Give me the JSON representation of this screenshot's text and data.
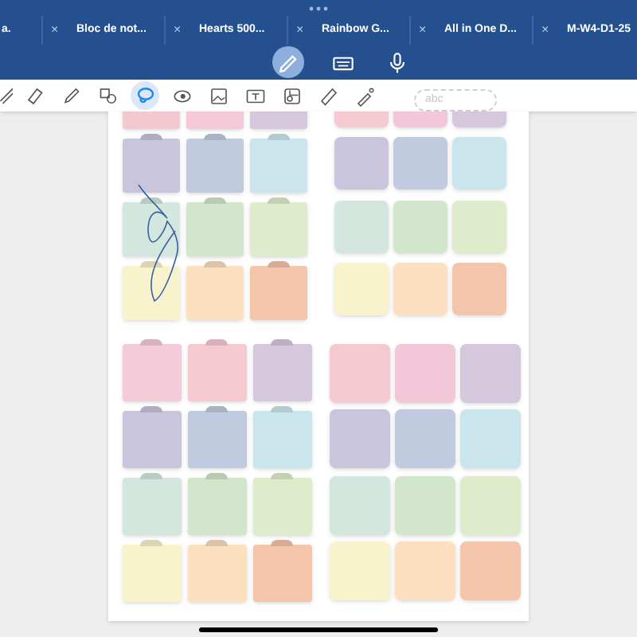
{
  "tabs": [
    {
      "label": "a."
    },
    {
      "label": "Bloc de not..."
    },
    {
      "label": "Hearts 500..."
    },
    {
      "label": "Rainbow G..."
    },
    {
      "label": "All in One D..."
    },
    {
      "label": "M-W4-D1-25"
    }
  ],
  "close_glyph": "×",
  "modes": [
    {
      "kind": "pen",
      "selected": true
    },
    {
      "kind": "keyboard",
      "selected": false
    },
    {
      "kind": "mic",
      "selected": false
    }
  ],
  "tools": [
    {
      "kind": "partial",
      "selected": false
    },
    {
      "kind": "eraser",
      "selected": false
    },
    {
      "kind": "pencil",
      "selected": false
    },
    {
      "kind": "shapes",
      "selected": false
    },
    {
      "kind": "lasso",
      "selected": true
    },
    {
      "kind": "eye",
      "selected": false
    },
    {
      "kind": "image",
      "selected": false
    },
    {
      "kind": "textbox",
      "selected": false
    },
    {
      "kind": "sticker",
      "selected": false
    },
    {
      "kind": "ruler",
      "selected": false
    },
    {
      "kind": "wand",
      "selected": false
    }
  ],
  "handwriting_field": {
    "placeholder": "abc"
  },
  "sticker_blocks": [
    {
      "sets": [
        {
          "kind": "tabbed",
          "rows": [
            [
              {
                "color": "#f3c9d1"
              },
              {
                "color": "#f4c8d6"
              },
              {
                "color": "#d6c8dc"
              }
            ],
            [
              {
                "color": "#c8c5dc"
              },
              {
                "color": "#c0cbe0"
              },
              {
                "color": "#cbe5ed"
              }
            ],
            [
              {
                "color": "#d3e7de"
              },
              {
                "color": "#d2e6cb"
              },
              {
                "color": "#dfeccb"
              }
            ],
            [
              {
                "color": "#f8f3cd"
              },
              {
                "color": "#fbdfbf"
              },
              {
                "color": "#f4c4ab"
              }
            ]
          ]
        },
        {
          "kind": "plain",
          "rows": [
            [
              {
                "color": "#f4c9d0"
              },
              {
                "color": "#f2c8d8"
              },
              {
                "color": "#d6c8dc"
              }
            ],
            [
              {
                "color": "#c8c5dc"
              },
              {
                "color": "#c0cbe0"
              },
              {
                "color": "#cbe5ed"
              }
            ],
            [
              {
                "color": "#d3e7de"
              },
              {
                "color": "#d2e6cb"
              },
              {
                "color": "#dfeccb"
              }
            ],
            [
              {
                "color": "#f8f3cd"
              },
              {
                "color": "#fbdfbf"
              },
              {
                "color": "#f4c4ab"
              }
            ]
          ]
        }
      ]
    },
    {
      "sets": [
        {
          "kind": "tabbed",
          "rows": [
            [
              {
                "color": "#f3cbd9"
              },
              {
                "color": "#f4c9d0"
              },
              {
                "color": "#d6c8dc"
              }
            ],
            [
              {
                "color": "#c8c5dc"
              },
              {
                "color": "#c0cbe0"
              },
              {
                "color": "#cbe5ed"
              }
            ],
            [
              {
                "color": "#d3e7de"
              },
              {
                "color": "#d2e6cb"
              },
              {
                "color": "#dfeccb"
              }
            ],
            [
              {
                "color": "#f8f3cd"
              },
              {
                "color": "#fbdfbf"
              },
              {
                "color": "#f4c4ab"
              }
            ]
          ]
        },
        {
          "kind": "plain",
          "rows": [
            [
              {
                "color": "#f4c9d0"
              },
              {
                "color": "#f2c8d8"
              },
              {
                "color": "#d6c8dc"
              }
            ],
            [
              {
                "color": "#c8c5dc"
              },
              {
                "color": "#c0cbe0"
              },
              {
                "color": "#cbe5ed"
              }
            ],
            [
              {
                "color": "#d3e7de"
              },
              {
                "color": "#d2e6cb"
              },
              {
                "color": "#dfeccb"
              }
            ],
            [
              {
                "color": "#f8f3cd"
              },
              {
                "color": "#fbdfbf"
              },
              {
                "color": "#f4c4ab"
              }
            ]
          ]
        }
      ]
    }
  ]
}
